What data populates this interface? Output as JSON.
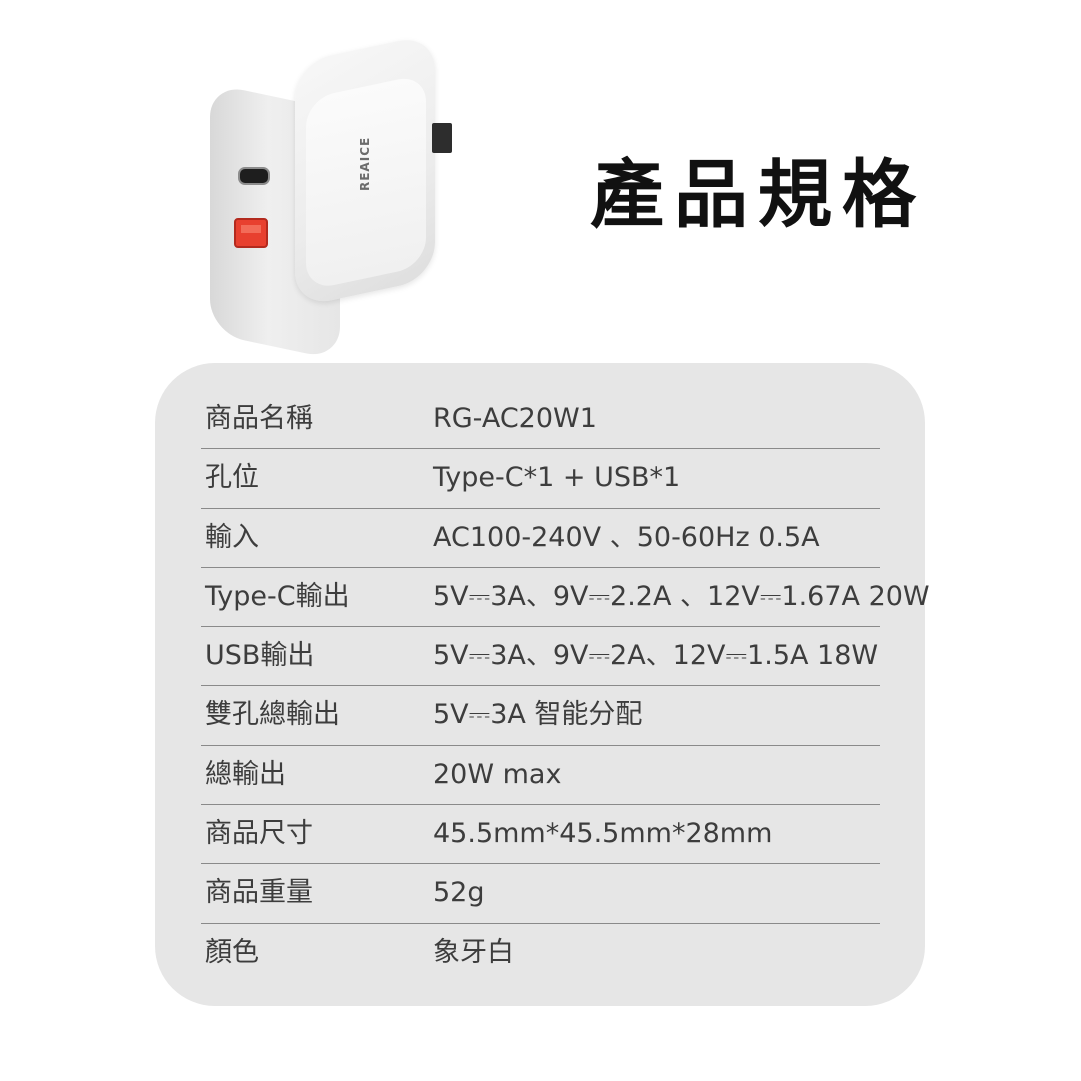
{
  "title": "產品規格",
  "product": {
    "brand": "REAICE"
  },
  "specs": [
    {
      "label": "商品名稱",
      "value": "RG-AC20W1"
    },
    {
      "label": "孔位",
      "value": "Type-C*1 + USB*1"
    },
    {
      "label": "輸入",
      "value": "AC100-240V 、50-60Hz 0.5A"
    },
    {
      "label": "Type-C輸出",
      "value": "5V⎓3A、9V⎓2.2A 、12V⎓1.67A 20W"
    },
    {
      "label": "USB輸出",
      "value": "5V⎓3A、9V⎓2A、12V⎓1.5A 18W"
    },
    {
      "label": "雙孔總輸出",
      "value": "5V⎓3A 智能分配"
    },
    {
      "label": "總輸出",
      "value": "20W max"
    },
    {
      "label": "商品尺寸",
      "value": "45.5mm*45.5mm*28mm"
    },
    {
      "label": "商品重量",
      "value": "52g"
    },
    {
      "label": "顏色",
      "value": "象牙白"
    }
  ],
  "colors": {
    "card_background": "#e6e6e6",
    "usb_port_accent": "#e8402f"
  }
}
